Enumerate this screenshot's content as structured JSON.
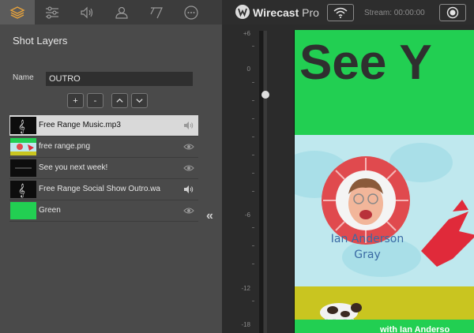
{
  "tabs": [
    {
      "icon": "layers-icon",
      "active": true
    },
    {
      "icon": "sliders-icon",
      "active": false
    },
    {
      "icon": "speaker-icon",
      "active": false
    },
    {
      "icon": "user-icon",
      "active": false
    },
    {
      "icon": "transition-icon",
      "active": false
    },
    {
      "icon": "more-icon",
      "active": false
    }
  ],
  "panel": {
    "title": "Shot Layers",
    "name_label": "Name",
    "name_value": "OUTRO",
    "add_label": "+",
    "remove_label": "-"
  },
  "layers": [
    {
      "label": "Free Range Music.mp3",
      "type": "audio",
      "selected": true,
      "visibility_icon": "speaker-icon"
    },
    {
      "label": "free range.png",
      "type": "image",
      "selected": false,
      "visibility_icon": "eye-icon"
    },
    {
      "label": "See you next week!",
      "type": "title",
      "selected": false,
      "visibility_icon": "eye-icon"
    },
    {
      "label": "Free Range Social Show Outro.wa",
      "type": "audio",
      "selected": false,
      "visibility_icon": "speaker-icon"
    },
    {
      "label": "Green",
      "type": "color",
      "selected": false,
      "visibility_icon": "eye-icon"
    }
  ],
  "collapse_label": "«",
  "topbar": {
    "app_name": "Wirecast",
    "app_edition": "Pro",
    "stream_label": "Stream:",
    "stream_time": "00:00:00"
  },
  "meter": {
    "ticks": [
      "+6",
      "0",
      "-6",
      "-12",
      "-18"
    ],
    "level_db": 0
  },
  "preview": {
    "headline": "See Y",
    "person_name_line1": "Ian Anderson",
    "person_name_line2": "Gray",
    "footer_text": "with Ian Anderso"
  },
  "colors": {
    "accent_green": "#22cf52",
    "tab_active_orange": "#e8a33c",
    "selected_row": "#d9d9d9"
  }
}
